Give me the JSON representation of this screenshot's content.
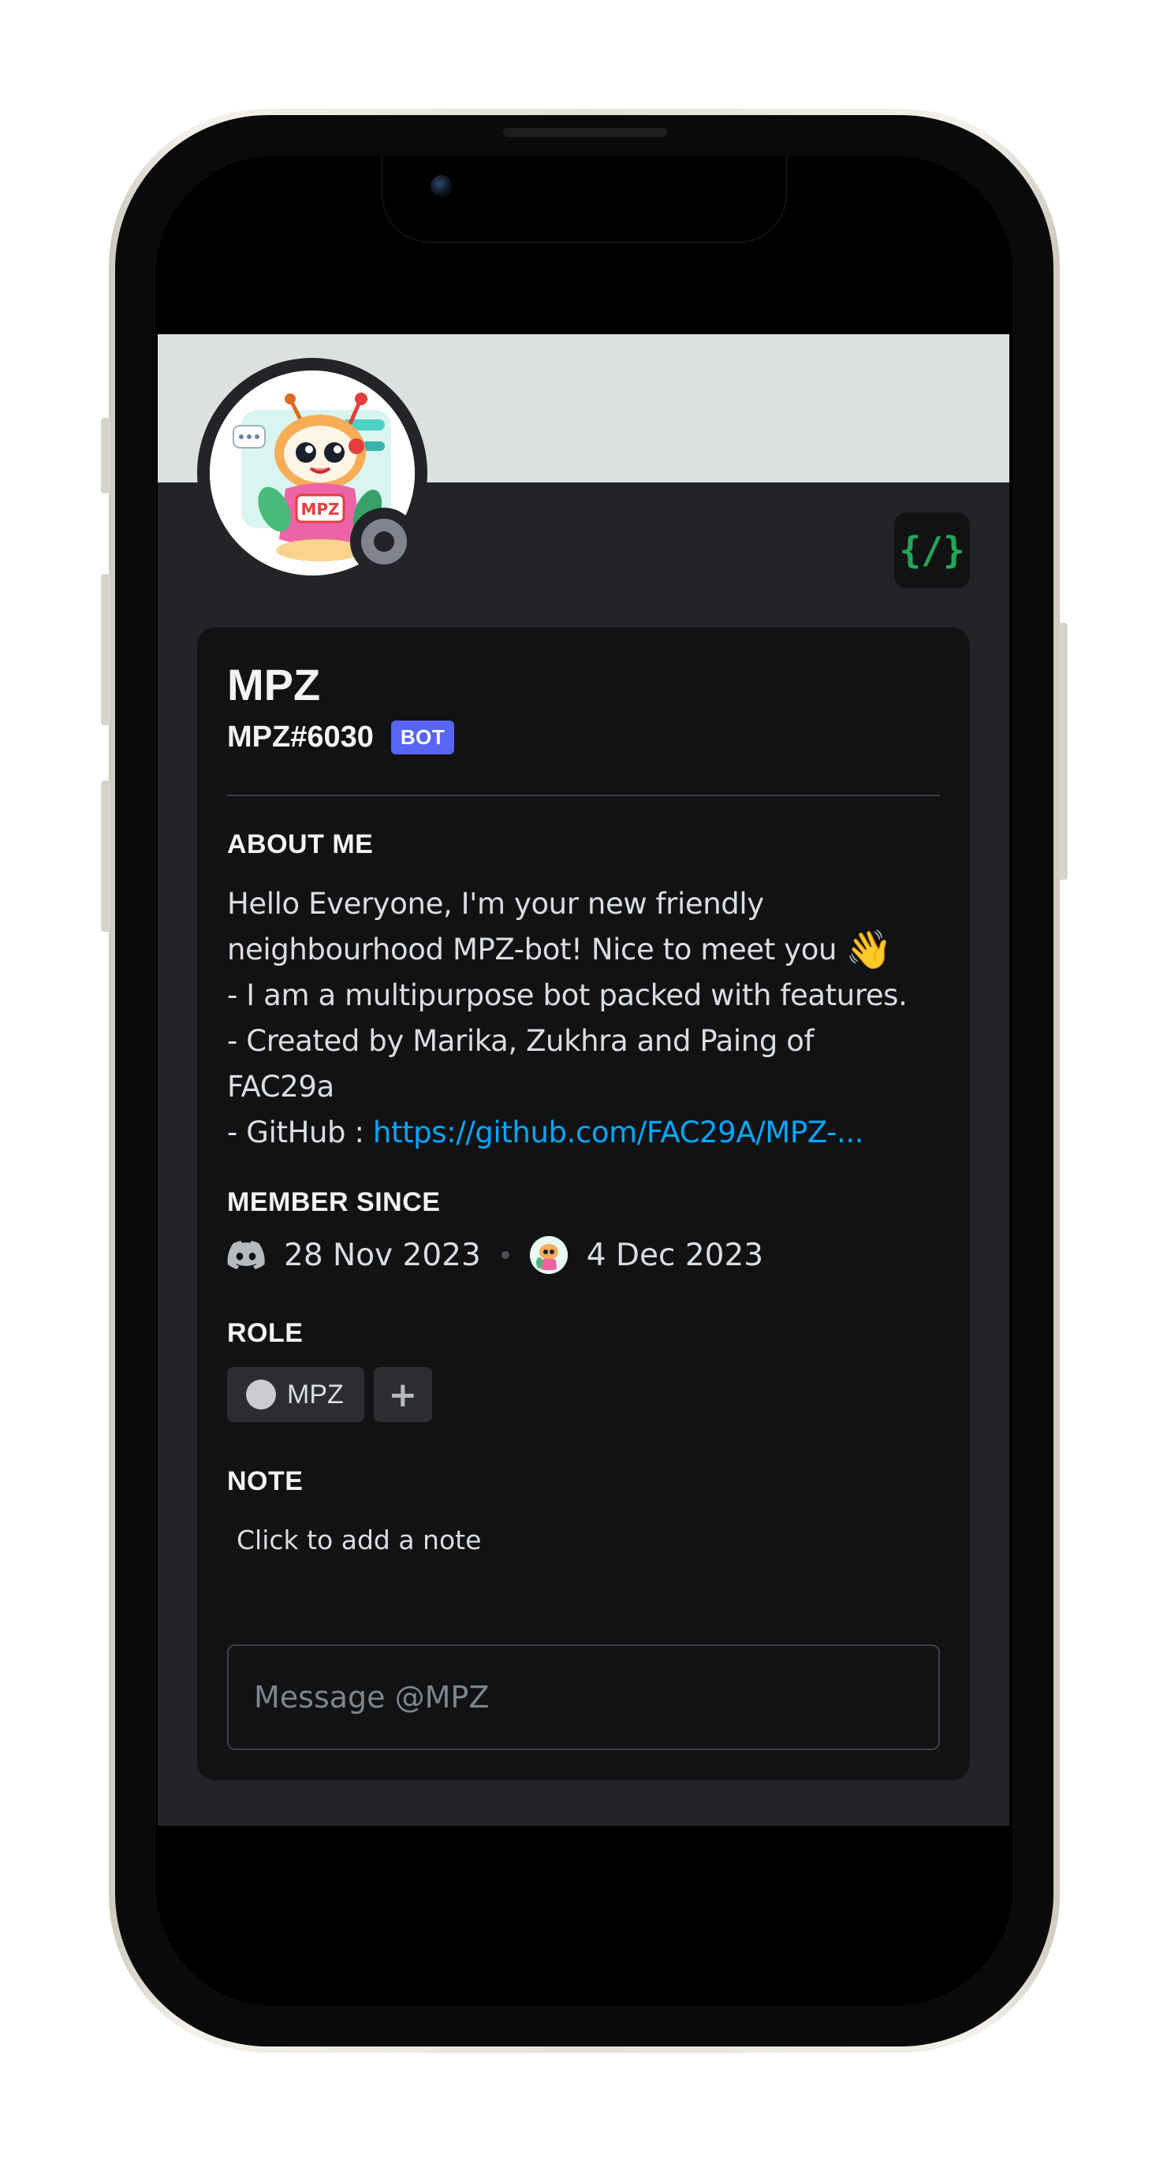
{
  "profile": {
    "display_name": "MPZ",
    "username": "MPZ#6030",
    "bot_tag": "BOT",
    "badge_label": "{/}",
    "about": {
      "title": "ABOUT ME",
      "line1": "Hello Everyone, I'm your new friendly",
      "line2": "neighbourhood MPZ-bot! Nice to meet you",
      "wave_emoji": "👋",
      "line3": "- I am a multipurpose bot packed with features.",
      "line4": "- Created by Marika, Zukhra and Paing of",
      "line5": "FAC29a",
      "github_prefix": "- GitHub : ",
      "github_link": "https://github.com/FAC29A/MPZ-...",
      "ellipsis": ""
    },
    "member_since": {
      "title": "MEMBER SINCE",
      "discord_date": "28 Nov 2023",
      "server_date": "4 Dec 2023"
    },
    "role": {
      "title": "ROLE",
      "name": "MPZ",
      "add_label": "+"
    },
    "note": {
      "title": "NOTE",
      "placeholder": "Click to add a note"
    },
    "message": {
      "placeholder": "Message @MPZ"
    },
    "avatar_text": "MPZ"
  },
  "colors": {
    "background": "#232428",
    "card": "#111214",
    "banner": "#dbe1df",
    "bot_tag": "#5865f2",
    "link": "#00a8fc",
    "status_offline": "#80848e",
    "badge_green": "#23a55a"
  },
  "icons": {
    "discord": "discord-logo-icon",
    "status": "offline-status-icon",
    "badge": "slash-commands-badge-icon",
    "wave": "waving-hand-icon"
  }
}
